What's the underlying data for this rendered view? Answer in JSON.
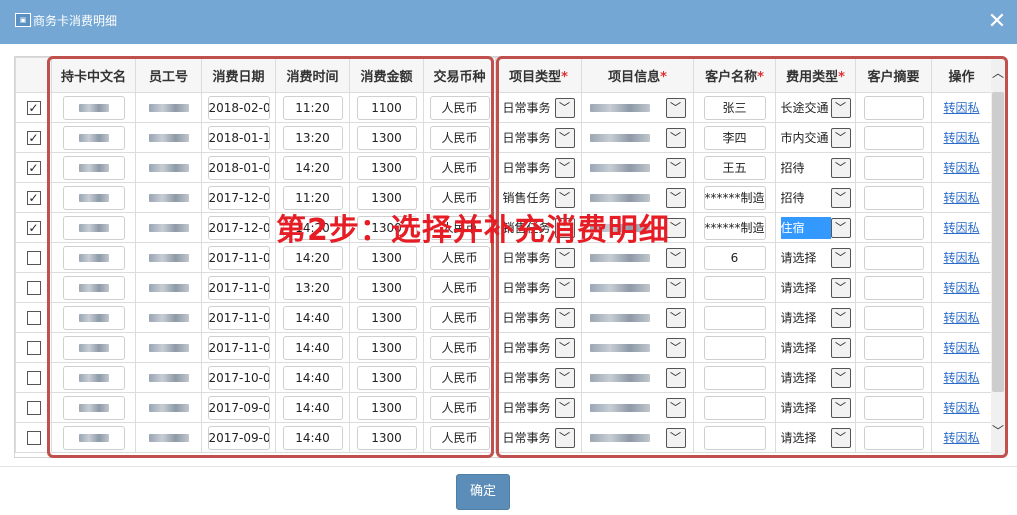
{
  "window": {
    "title": "商务卡消费明细",
    "icon": "card-icon",
    "close_glyph": "✕"
  },
  "annotation": "第2步：选择并补充消费明细",
  "headers": [
    "",
    "持卡中文名",
    "员工号",
    "消费日期",
    "消费时间",
    "消费金额",
    "交易币种",
    "项目类型",
    "项目信息",
    "客户名称",
    "费用类型",
    "客户摘要",
    "操作"
  ],
  "required_mark": "*",
  "rows": [
    {
      "checked": true,
      "date": "2018-02-0",
      "time": "11:20",
      "amount": "1100",
      "currency": "人民币",
      "project_type": "日常事务",
      "customer": "张三",
      "expense_type": "长途交通",
      "highlight": false,
      "action": "转因私"
    },
    {
      "checked": true,
      "date": "2018-01-1",
      "time": "13:20",
      "amount": "1300",
      "currency": "人民币",
      "project_type": "日常事务",
      "customer": "李四",
      "expense_type": "市内交通",
      "highlight": false,
      "action": "转因私"
    },
    {
      "checked": true,
      "date": "2018-01-0",
      "time": "14:20",
      "amount": "1300",
      "currency": "人民币",
      "project_type": "日常事务",
      "customer": "王五",
      "expense_type": "招待",
      "highlight": false,
      "action": "转因私"
    },
    {
      "checked": true,
      "date": "2017-12-0",
      "time": "11:20",
      "amount": "1300",
      "currency": "人民币",
      "project_type": "销售任务",
      "customer": "******制造有",
      "expense_type": "招待",
      "highlight": false,
      "action": "转因私"
    },
    {
      "checked": true,
      "date": "2017-12-0",
      "time": "14:20",
      "amount": "1300",
      "currency": "人民币",
      "project_type": "销售任务",
      "customer": "******制造有",
      "expense_type": "住宿",
      "highlight": true,
      "action": "转因私"
    },
    {
      "checked": false,
      "date": "2017-11-0",
      "time": "14:20",
      "amount": "1300",
      "currency": "人民币",
      "project_type": "日常事务",
      "customer": "6",
      "expense_type": "请选择",
      "highlight": false,
      "action": "转因私"
    },
    {
      "checked": false,
      "date": "2017-11-0",
      "time": "13:20",
      "amount": "1300",
      "currency": "人民币",
      "project_type": "日常事务",
      "customer": "",
      "expense_type": "请选择",
      "highlight": false,
      "action": "转因私"
    },
    {
      "checked": false,
      "date": "2017-11-0",
      "time": "14:40",
      "amount": "1300",
      "currency": "人民币",
      "project_type": "日常事务",
      "customer": "",
      "expense_type": "请选择",
      "highlight": false,
      "action": "转因私"
    },
    {
      "checked": false,
      "date": "2017-11-0",
      "time": "14:40",
      "amount": "1300",
      "currency": "人民币",
      "project_type": "日常事务",
      "customer": "",
      "expense_type": "请选择",
      "highlight": false,
      "action": "转因私"
    },
    {
      "checked": false,
      "date": "2017-10-0",
      "time": "14:40",
      "amount": "1300",
      "currency": "人民币",
      "project_type": "日常事务",
      "customer": "",
      "expense_type": "请选择",
      "highlight": false,
      "action": "转因私"
    },
    {
      "checked": false,
      "date": "2017-09-0",
      "time": "14:40",
      "amount": "1300",
      "currency": "人民币",
      "project_type": "日常事务",
      "customer": "",
      "expense_type": "请选择",
      "highlight": false,
      "action": "转因私"
    },
    {
      "checked": false,
      "date": "2017-09-0",
      "time": "14:40",
      "amount": "1300",
      "currency": "人民币",
      "project_type": "日常事务",
      "customer": "",
      "expense_type": "请选择",
      "highlight": false,
      "action": "转因私"
    }
  ],
  "footer": {
    "confirm_label": "确定"
  },
  "colors": {
    "titlebar": "#74a7d3",
    "annotation_red": "#e61d25",
    "box_red": "#c0504d",
    "link": "#2a6cc8",
    "button": "#5b8db8",
    "highlight": "#3399ff"
  },
  "icons": {
    "check": "✓",
    "dropdown": "chevron-down-icon",
    "scroll_up": "chevron-up-icon",
    "scroll_down": "chevron-down-icon"
  }
}
